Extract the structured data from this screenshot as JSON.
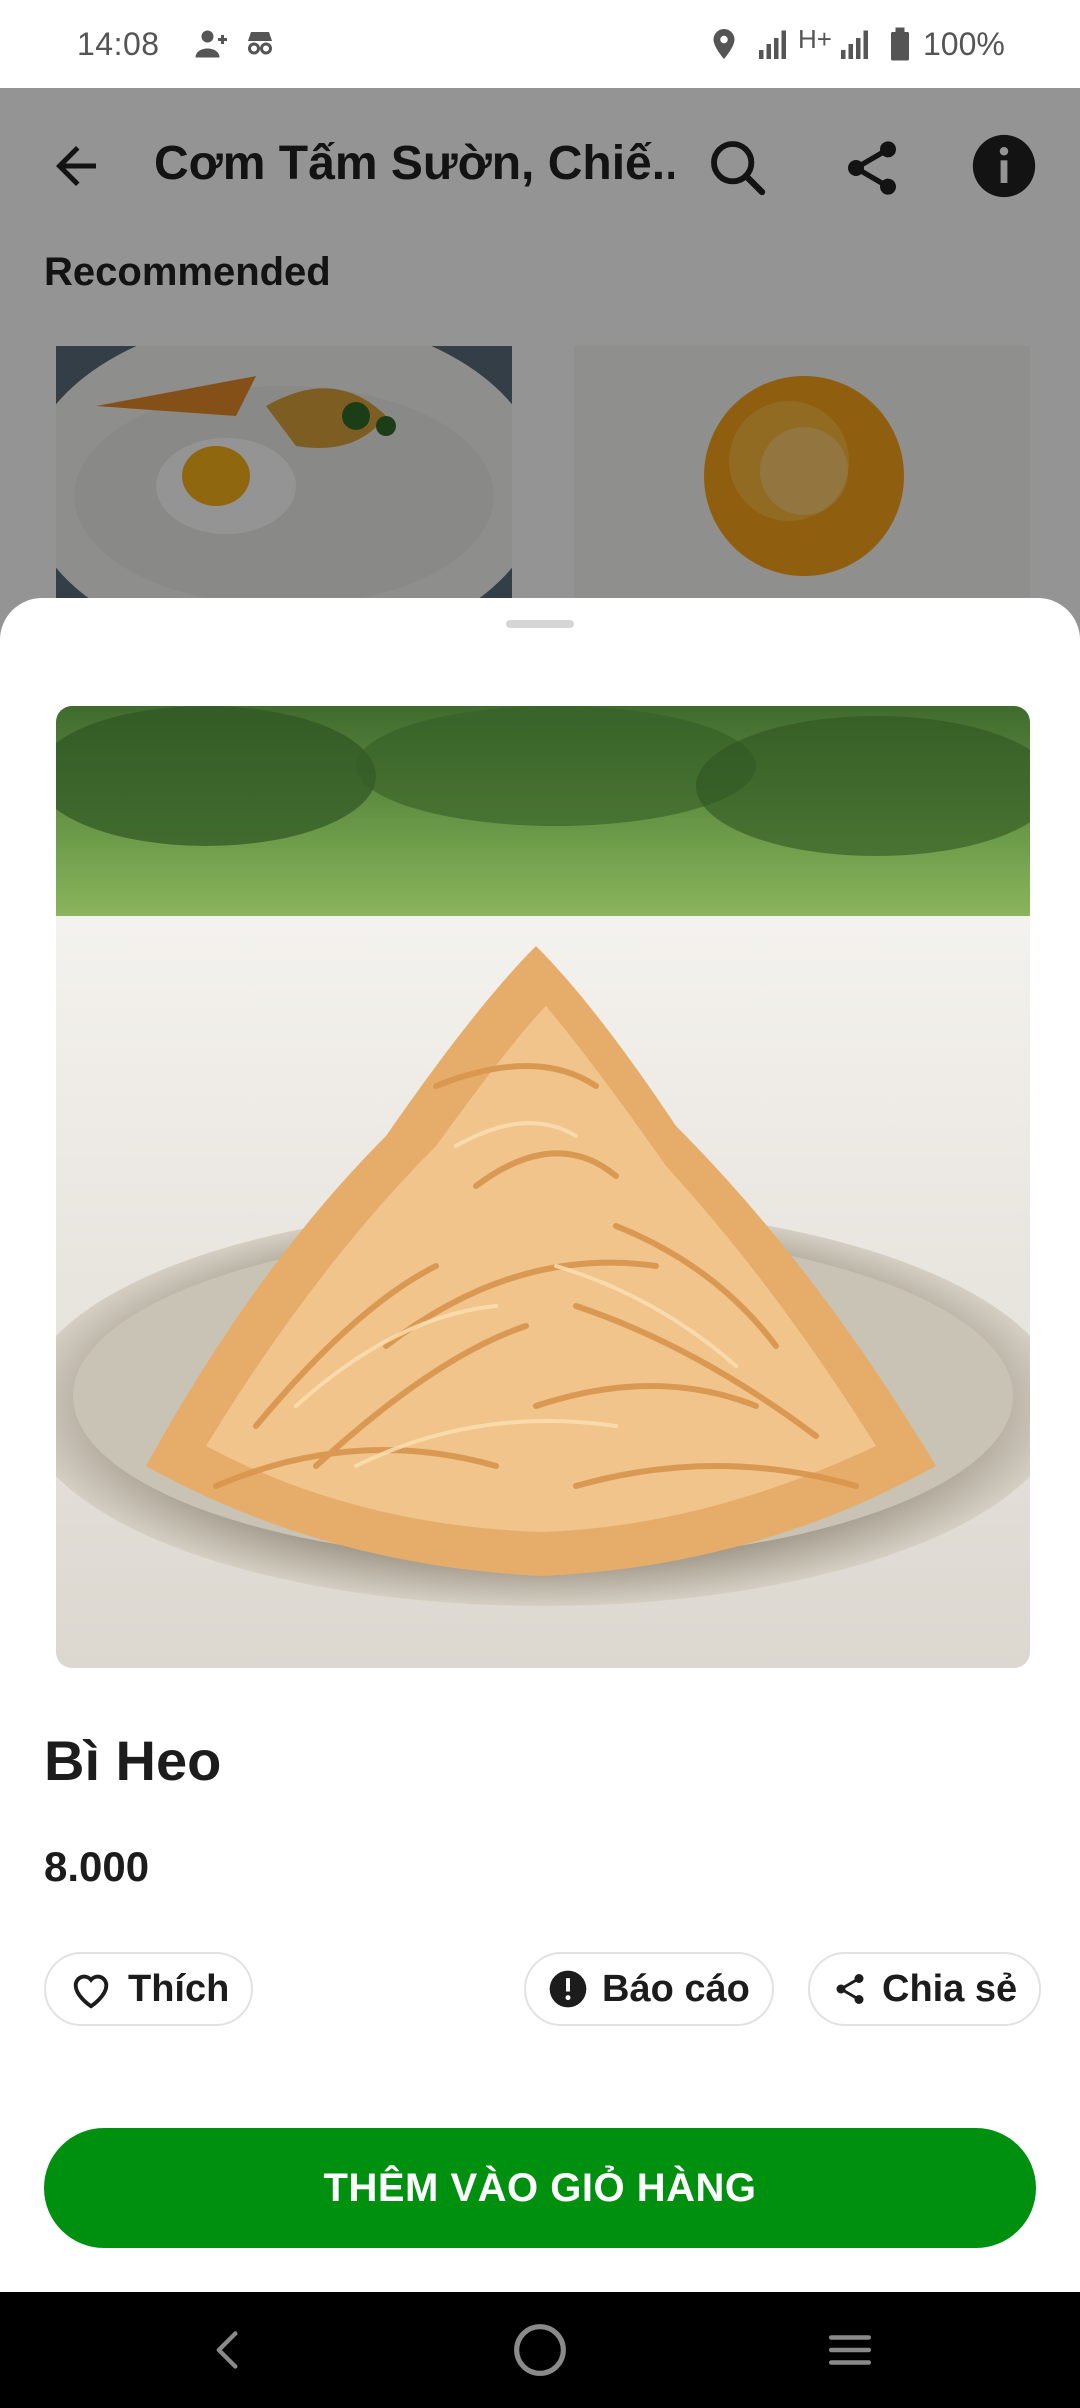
{
  "status_bar": {
    "time": "14:08",
    "network": "H+",
    "battery": "100%",
    "icons": [
      "person-add-icon",
      "incognito-icon",
      "location-icon",
      "signal-icon",
      "signal-h-plus-icon",
      "signal-icon",
      "battery-icon"
    ]
  },
  "header": {
    "title": "Cơm Tấm Sườn, Chiế...",
    "section": "Recommended",
    "icons": [
      "back-arrow-icon",
      "search-icon",
      "share-icon",
      "info-icon"
    ]
  },
  "background_thumbnails": [
    "rice-with-egg-photo",
    "fried-egg-photo"
  ],
  "item": {
    "name": "Bì Heo",
    "price": "8.000",
    "image": "shredded-pork-skin-photo"
  },
  "actions": {
    "like": "Thích",
    "report": "Báo cáo",
    "share": "Chia sẻ"
  },
  "add_to_cart": "THÊM VÀO GIỎ HÀNG",
  "colors": {
    "primary": "#00900f",
    "text": "#1c1c1c",
    "overlay": "rgba(0,0,0,0.42)"
  },
  "nav": [
    "back-icon",
    "home-icon",
    "recents-icon"
  ]
}
